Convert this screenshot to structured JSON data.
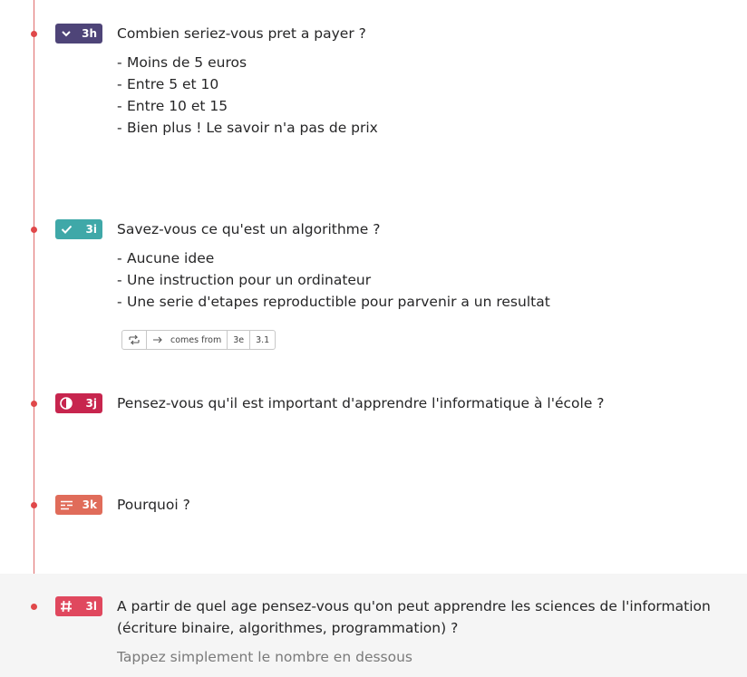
{
  "questions": [
    {
      "number": "3h",
      "icon": "chevron-down-icon",
      "color": "#4e4478",
      "title": "Combien seriez-vous pret a payer ?",
      "options": [
        "Moins de 5 euros",
        "Entre 5 et 10",
        "Entre 10 et 15",
        "Bien plus ! Le savoir n'a pas de prix"
      ]
    },
    {
      "number": "3i",
      "icon": "check-icon",
      "color": "#3fa8a8",
      "title": "Savez-vous ce qu'est un algorithme ?",
      "options": [
        "Aucune idee",
        "Une instruction pour un ordinateur",
        "Une serie d'etapes reproductible pour parvenir a un resultat"
      ],
      "logic": {
        "label": "comes from",
        "refs": [
          "3e",
          "3.1"
        ]
      }
    },
    {
      "number": "3j",
      "icon": "opinion-scale-icon",
      "color": "#c7254e",
      "title": "Pensez-vous qu'il est important d'apprendre l'informatique à l'école ?"
    },
    {
      "number": "3k",
      "icon": "long-text-icon",
      "color": "#e06c5a",
      "title": "Pourquoi ?"
    },
    {
      "number": "3l",
      "icon": "hash-icon",
      "color": "#e0485e",
      "title": "A partir de quel age pensez-vous qu'on peut apprendre les sciences de l'information (écriture binaire, algorithmes, programmation) ?",
      "hint": "Tappez simplement le nombre en dessous"
    }
  ],
  "dash": "-"
}
